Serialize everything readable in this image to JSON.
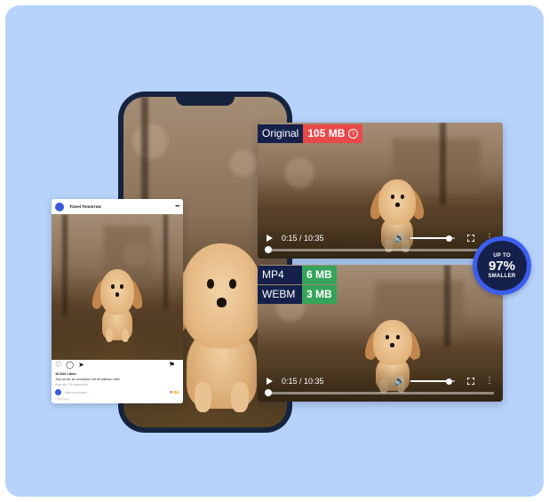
{
  "post": {
    "username": "Travel Tomorrow",
    "more": "•••",
    "likes": "10,542 Likes",
    "caption": "Join us for an exclusive hot air balloon ride!",
    "view_comments": "View all 175 comments",
    "comment_placeholder": "Add a comment...",
    "time_ago": "2 days ago",
    "emojis": "♥ 🙌"
  },
  "player_original": {
    "format_label": "Original",
    "size": "105 MB",
    "info_icon": "i",
    "time": "0:15 / 10:35",
    "progress": 0.02,
    "volume": 0.85
  },
  "player_compressed": {
    "formats": [
      {
        "label": "MP4",
        "size": "6 MB"
      },
      {
        "label": "WEBM",
        "size": "3 MB"
      }
    ],
    "time": "0:15 / 10:35",
    "progress": 0.02,
    "volume": 0.85
  },
  "badge": {
    "top": "UP TO",
    "value": "97%",
    "bottom": "SMALLER"
  },
  "colors": {
    "background": "#b7d3fb",
    "navy": "#15214a",
    "accent_blue": "#3b5ef0",
    "red": "#e84a4a",
    "green": "#36a35a"
  },
  "icons": [
    "play-icon",
    "volume-icon",
    "fullscreen-icon",
    "more-vertical-icon",
    "heart-icon",
    "comment-icon",
    "share-icon",
    "bookmark-icon",
    "info-icon"
  ]
}
